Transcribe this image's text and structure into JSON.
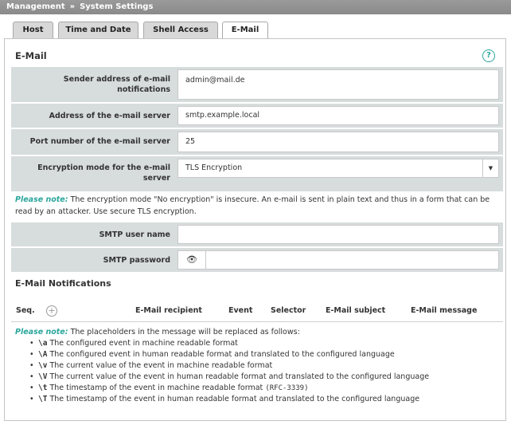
{
  "breadcrumb": {
    "parent": "Management",
    "separator": "»",
    "current": "System Settings"
  },
  "tabs": [
    {
      "label": "Host",
      "active": false
    },
    {
      "label": "Time and Date",
      "active": false
    },
    {
      "label": "Shell Access",
      "active": false
    },
    {
      "label": "E-Mail",
      "active": true
    }
  ],
  "section": {
    "title": "E-Mail",
    "help_icon": "question-circle-icon",
    "help_glyph": "?"
  },
  "form": {
    "sender": {
      "label_line1": "Sender address of e-mail",
      "label_line2": "notifications",
      "value": "admin@mail.de"
    },
    "server": {
      "label": "Address of the e-mail server",
      "value": "smtp.example.local"
    },
    "port": {
      "label": "Port number of the e-mail server",
      "value": "25"
    },
    "encryption": {
      "label_line1": "Encryption mode for the e-mail",
      "label_line2": "server",
      "value": "TLS Encryption",
      "arrow": "▼"
    },
    "smtp_user": {
      "label": "SMTP user name",
      "value": ""
    },
    "smtp_password": {
      "label": "SMTP password",
      "value": "",
      "eye_glyph": "👁"
    }
  },
  "note1": {
    "prefix": "Please note:",
    "text_line1": "The encryption mode \"No encryption\" is insecure. An e-mail is sent in plain text and thus in a form that can be",
    "text_line2": "read by an attacker. Use secure TLS encryption."
  },
  "notifications": {
    "title": "E-Mail Notifications",
    "add_glyph": "+",
    "columns": {
      "seq": "Seq.",
      "recipient": "E-Mail recipient",
      "event": "Event",
      "selector": "Selector",
      "subject": "E-Mail subject",
      "message": "E-Mail message"
    }
  },
  "note2": {
    "prefix": "Please note:",
    "text": "The placeholders in the message will be replaced as follows:",
    "items": [
      {
        "code": "\\a",
        "text": "The configured event in machine readable format",
        "extra": ""
      },
      {
        "code": "\\A",
        "text": "The configured event in human readable format and translated to the configured language",
        "extra": ""
      },
      {
        "code": "\\v",
        "text": "The current value of the event in machine readable format",
        "extra": ""
      },
      {
        "code": "\\V",
        "text": "The current value of the event in human readable format and translated to the configured language",
        "extra": ""
      },
      {
        "code": "\\t",
        "text": "The timestamp of the event in machine readable format",
        "extra": "(RFC-3339)"
      },
      {
        "code": "\\T",
        "text": "The timestamp of the event in human readable format and translated to the configured language",
        "extra": ""
      }
    ]
  },
  "colors": {
    "accent": "#2aa69c",
    "label_bg": "#d7dcdc",
    "topbar": "#8f8f8f"
  }
}
